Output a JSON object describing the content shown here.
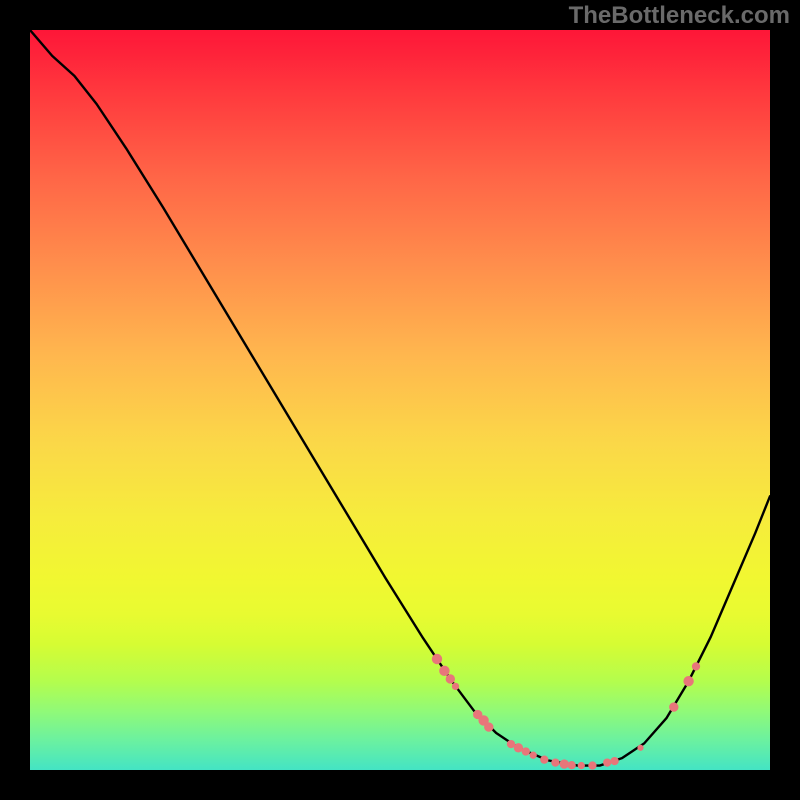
{
  "chart_data": {
    "type": "line",
    "watermark": "TheBottleneck.com",
    "xlim": [
      0,
      100
    ],
    "ylim": [
      0,
      100
    ],
    "curve": [
      {
        "x": 0.0,
        "y": 100.0
      },
      {
        "x": 3.0,
        "y": 96.5
      },
      {
        "x": 6.0,
        "y": 93.8
      },
      {
        "x": 9.0,
        "y": 90.0
      },
      {
        "x": 13.0,
        "y": 84.0
      },
      {
        "x": 18.0,
        "y": 76.0
      },
      {
        "x": 24.0,
        "y": 66.0
      },
      {
        "x": 30.0,
        "y": 56.0
      },
      {
        "x": 36.0,
        "y": 46.0
      },
      {
        "x": 42.0,
        "y": 36.0
      },
      {
        "x": 48.0,
        "y": 26.0
      },
      {
        "x": 53.0,
        "y": 18.0
      },
      {
        "x": 57.0,
        "y": 12.0
      },
      {
        "x": 60.0,
        "y": 8.0
      },
      {
        "x": 63.0,
        "y": 5.0
      },
      {
        "x": 66.0,
        "y": 3.0
      },
      {
        "x": 70.0,
        "y": 1.3
      },
      {
        "x": 74.0,
        "y": 0.6
      },
      {
        "x": 77.0,
        "y": 0.6
      },
      {
        "x": 80.0,
        "y": 1.6
      },
      {
        "x": 83.0,
        "y": 3.6
      },
      {
        "x": 86.0,
        "y": 7.0
      },
      {
        "x": 89.0,
        "y": 12.0
      },
      {
        "x": 92.0,
        "y": 18.0
      },
      {
        "x": 95.0,
        "y": 25.0
      },
      {
        "x": 98.0,
        "y": 32.0
      },
      {
        "x": 100.0,
        "y": 37.0
      }
    ],
    "markers": [
      {
        "x": 55.0,
        "y": 15.0,
        "r": 1.0
      },
      {
        "x": 56.0,
        "y": 13.4,
        "r": 1.0
      },
      {
        "x": 56.8,
        "y": 12.3,
        "r": 0.9
      },
      {
        "x": 57.5,
        "y": 11.3,
        "r": 0.7
      },
      {
        "x": 60.5,
        "y": 7.5,
        "r": 0.9
      },
      {
        "x": 61.3,
        "y": 6.7,
        "r": 1.0
      },
      {
        "x": 62.0,
        "y": 5.8,
        "r": 0.9
      },
      {
        "x": 65.0,
        "y": 3.5,
        "r": 0.8
      },
      {
        "x": 66.0,
        "y": 3.0,
        "r": 0.9
      },
      {
        "x": 67.0,
        "y": 2.5,
        "r": 0.8
      },
      {
        "x": 68.0,
        "y": 2.0,
        "r": 0.7
      },
      {
        "x": 69.5,
        "y": 1.4,
        "r": 0.8
      },
      {
        "x": 71.0,
        "y": 1.0,
        "r": 0.8
      },
      {
        "x": 72.2,
        "y": 0.8,
        "r": 0.9
      },
      {
        "x": 73.2,
        "y": 0.65,
        "r": 0.8
      },
      {
        "x": 74.5,
        "y": 0.6,
        "r": 0.7
      },
      {
        "x": 76.0,
        "y": 0.6,
        "r": 0.8
      },
      {
        "x": 78.0,
        "y": 1.0,
        "r": 0.8
      },
      {
        "x": 79.0,
        "y": 1.2,
        "r": 0.8
      },
      {
        "x": 82.5,
        "y": 3.0,
        "r": 0.6
      },
      {
        "x": 87.0,
        "y": 8.5,
        "r": 0.9
      },
      {
        "x": 89.0,
        "y": 12.0,
        "r": 1.0
      },
      {
        "x": 90.0,
        "y": 14.0,
        "r": 0.8
      }
    ]
  }
}
